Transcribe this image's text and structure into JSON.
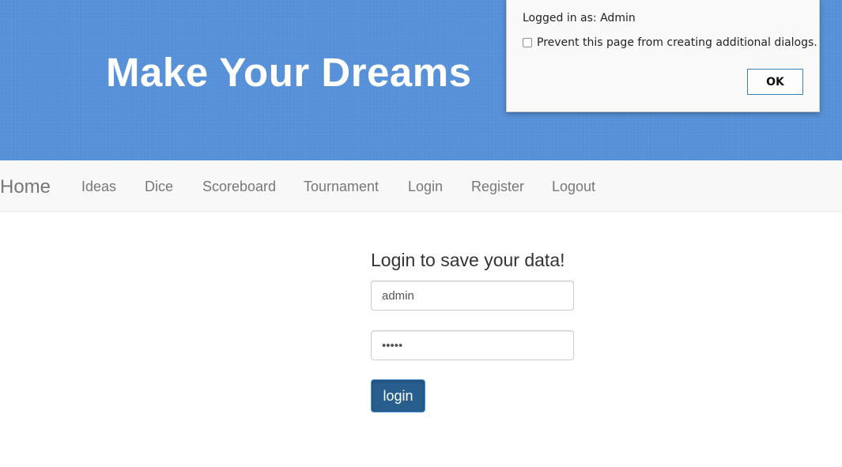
{
  "banner": {
    "title": "Make Your Dreams"
  },
  "nav": {
    "brand": "Home",
    "items": [
      {
        "label": "Ideas"
      },
      {
        "label": "Dice"
      },
      {
        "label": "Scoreboard"
      },
      {
        "label": "Tournament"
      },
      {
        "label": "Login"
      },
      {
        "label": "Register"
      },
      {
        "label": "Logout"
      }
    ]
  },
  "login": {
    "heading": "Login to save your data!",
    "username_value": "admin",
    "password_value": "•••••",
    "button_label": "login"
  },
  "dialog": {
    "message": "Logged in as: Admin",
    "checkbox_label": "Prevent this page from creating additional dialogs.",
    "checkbox_checked": false,
    "ok_label": "OK"
  },
  "colors": {
    "banner": "#5590d8",
    "login_button": "#285e8e",
    "navbar": "#f8f8f8"
  }
}
